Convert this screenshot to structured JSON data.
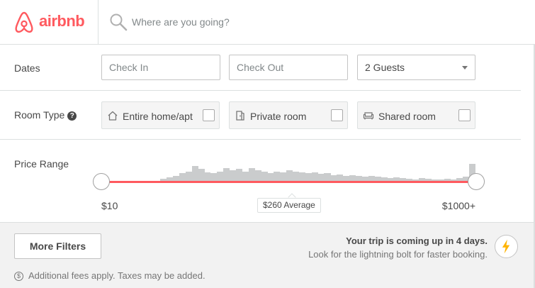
{
  "header": {
    "logo_text": "airbnb",
    "search_placeholder": "Where are you going?"
  },
  "dates": {
    "label": "Dates",
    "check_in_placeholder": "Check In",
    "check_out_placeholder": "Check Out",
    "guests_value": "2 Guests"
  },
  "room_type": {
    "label": "Room Type",
    "help_glyph": "?",
    "options": [
      {
        "label": "Entire home/apt",
        "icon": "home-icon",
        "checked": false
      },
      {
        "label": "Private room",
        "icon": "door-icon",
        "checked": false
      },
      {
        "label": "Shared room",
        "icon": "couch-icon",
        "checked": false
      }
    ]
  },
  "price_range": {
    "label": "Price Range",
    "min_label": "$10",
    "max_label": "$1000+",
    "average_label": "$260 Average",
    "histogram_levels": [
      0.05,
      0.08,
      0.12,
      0.18,
      0.22,
      0.35,
      0.28,
      0.2,
      0.18,
      0.22,
      0.3,
      0.25,
      0.28,
      0.22,
      0.3,
      0.25,
      0.22,
      0.18,
      0.22,
      0.2,
      0.25,
      0.22,
      0.2,
      0.18,
      0.2,
      0.16,
      0.18,
      0.14,
      0.15,
      0.12,
      0.13,
      0.12,
      0.1,
      0.12,
      0.1,
      0.08,
      0.06,
      0.08,
      0.06,
      0.05,
      0.04,
      0.06,
      0.05,
      0.04,
      0.03,
      0.05,
      0.04,
      0.06,
      0.1,
      0.4
    ]
  },
  "footer": {
    "more_filters_label": "More Filters",
    "trip_title": "Your trip is coming up in 4 days.",
    "trip_subtitle": "Look for the lightning bolt for faster booking.",
    "fee_glyph": "$",
    "fees_note": "Additional fees apply. Taxes may be added."
  },
  "colors": {
    "brand": "#ff5a5f",
    "bolt": "#ffb400",
    "histogram": "#cacccd"
  }
}
